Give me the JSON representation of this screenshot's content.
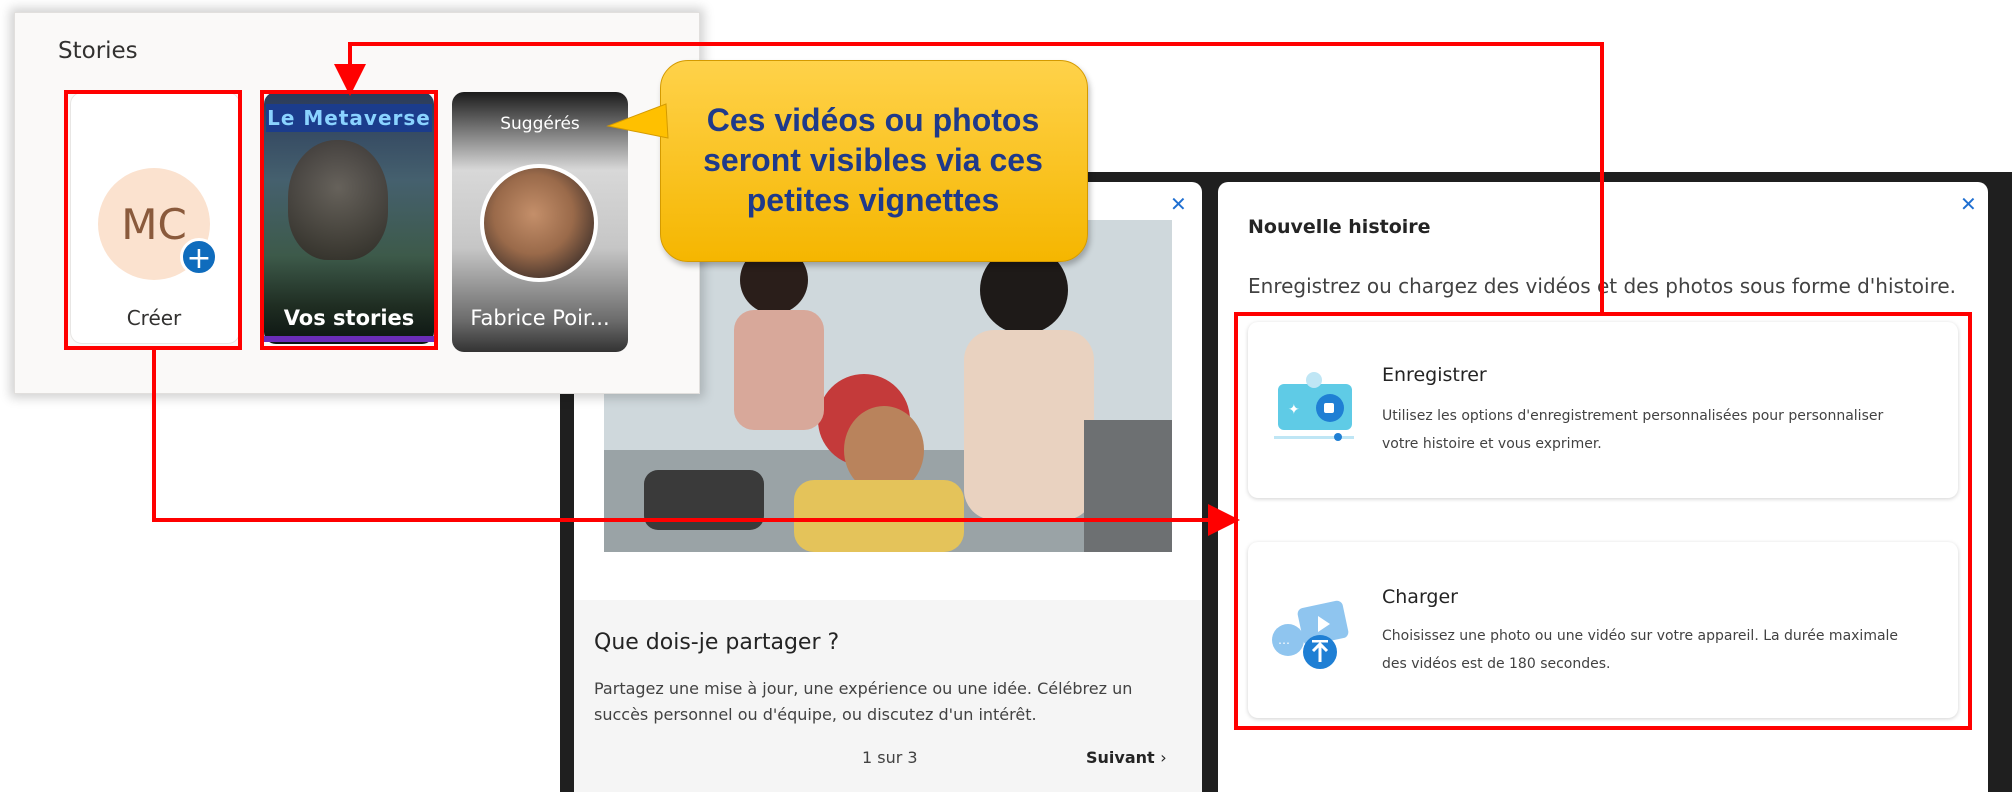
{
  "stories": {
    "title": "Stories",
    "create_initials": "MC",
    "create_label": "Créer",
    "your_label": "Vos stories",
    "your_banner": "Le Metaverse",
    "suggested_label": "Suggérés",
    "suggested_name": "Fabrice Poir..."
  },
  "callout": {
    "line1": "Ces vidéos ou photos",
    "line2": "seront visibles via ces",
    "line3": "petites vignettes"
  },
  "share_dialog": {
    "title": "Que dois-je partager ?",
    "description": "Partagez une mise à jour, une expérience ou une idée. Célébrez un succès personnel ou d'équipe, ou discutez d'un intérêt.",
    "pager": "1 sur 3",
    "next_label": "Suivant",
    "close_icon": "close-icon"
  },
  "new_story": {
    "title": "Nouvelle histoire",
    "subtitle": "Enregistrez ou chargez des vidéos et des photos sous forme d'histoire.",
    "options": [
      {
        "title": "Enregistrer",
        "description": "Utilisez les options d'enregistrement personnalisées pour personnaliser votre histoire et vous exprimer.",
        "icon": "record-video-icon"
      },
      {
        "title": "Charger",
        "description": "Choisissez une photo ou une vidéo sur votre appareil. La durée maximale des vidéos est de 180 secondes.",
        "icon": "upload-media-icon"
      }
    ]
  },
  "colors": {
    "annotation_red": "#ff0000",
    "callout_yellow": "#ffc000",
    "callout_text": "#1f3a8a",
    "accent_blue": "#0f6cbd"
  }
}
